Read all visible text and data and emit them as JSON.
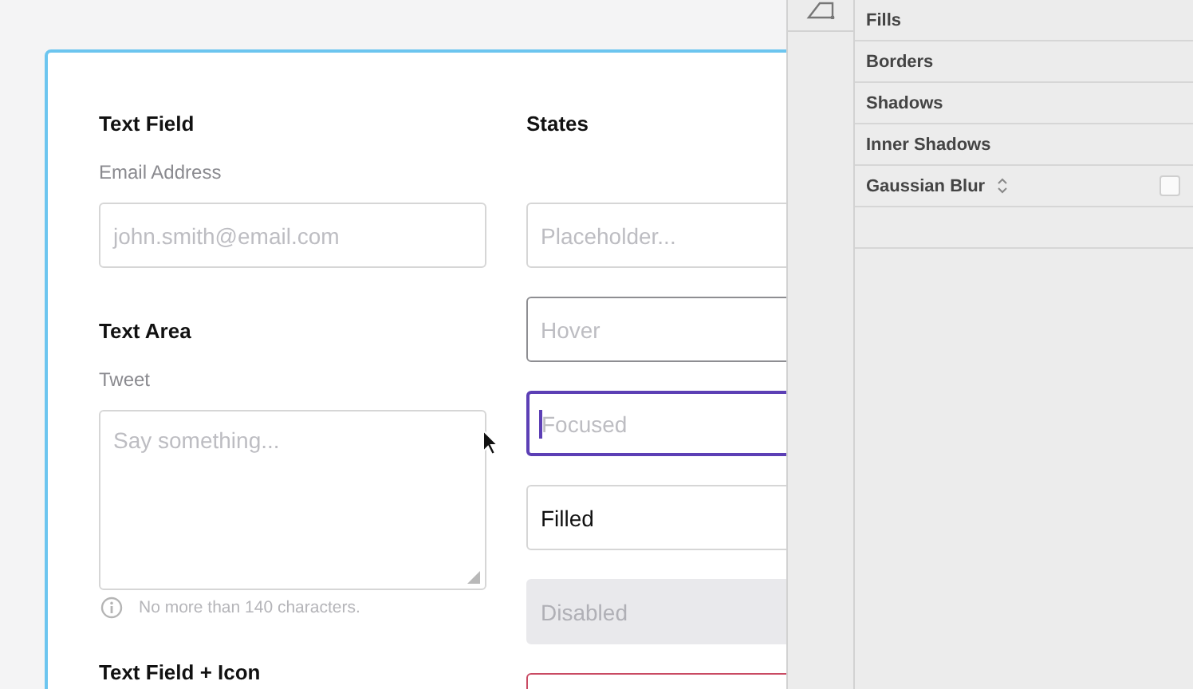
{
  "text_field": {
    "heading": "Text Field",
    "label": "Email Address",
    "placeholder": "john.smith@email.com"
  },
  "text_area": {
    "heading": "Text Area",
    "label": "Tweet",
    "placeholder": "Say something...",
    "hint": "No more than 140 characters."
  },
  "text_field_icon": {
    "heading": "Text Field + Icon"
  },
  "states": {
    "heading": "States",
    "fields": [
      {
        "kind": "placeholder",
        "text": "Placeholder..."
      },
      {
        "kind": "hover",
        "text": "Hover"
      },
      {
        "kind": "focused",
        "text": "Focused"
      },
      {
        "kind": "filled",
        "text": "Filled"
      },
      {
        "kind": "disabled",
        "text": "Disabled"
      },
      {
        "kind": "error"
      }
    ]
  },
  "inspector": {
    "sections": [
      {
        "label": "Fills"
      },
      {
        "label": "Borders"
      },
      {
        "label": "Shadows"
      },
      {
        "label": "Inner Shadows"
      },
      {
        "label": "Gaussian Blur",
        "kind": "select",
        "checked": false
      }
    ]
  }
}
